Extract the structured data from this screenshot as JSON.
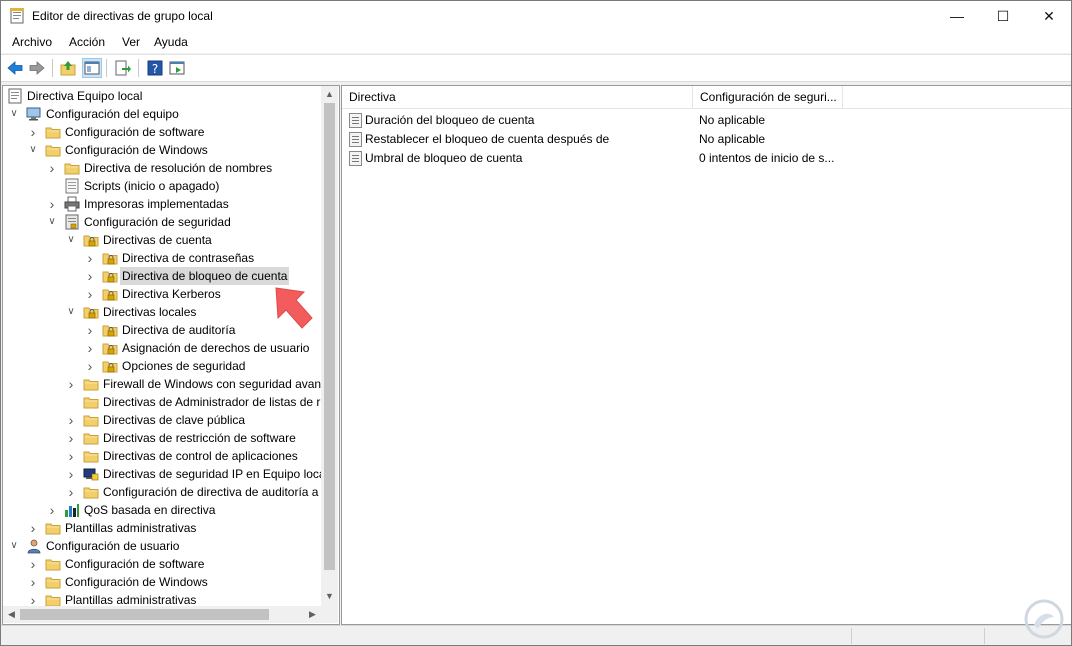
{
  "window": {
    "title": "Editor de directivas de grupo local"
  },
  "menu": [
    "Archivo",
    "Acción",
    "Ver",
    "Ayuda"
  ],
  "tree": [
    {
      "label": "Directiva Equipo local",
      "indent": 0,
      "expander": "",
      "icon": "policy-doc-icon"
    },
    {
      "label": "Configuración del equipo",
      "indent": 1,
      "expander": "open",
      "icon": "computer-icon"
    },
    {
      "label": "Configuración de software",
      "indent": 2,
      "expander": "closed",
      "icon": "folder-icon"
    },
    {
      "label": "Configuración de Windows",
      "indent": 2,
      "expander": "open",
      "icon": "folder-icon"
    },
    {
      "label": "Directiva de resolución de nombres",
      "indent": 3,
      "expander": "closed",
      "icon": "folder-icon"
    },
    {
      "label": "Scripts (inicio o apagado)",
      "indent": 3,
      "expander": "",
      "icon": "scripts-icon"
    },
    {
      "label": "Impresoras implementadas",
      "indent": 3,
      "expander": "closed",
      "icon": "printer-icon"
    },
    {
      "label": "Configuración de seguridad",
      "indent": 3,
      "expander": "open",
      "icon": "security-config-icon"
    },
    {
      "label": "Directivas de cuenta",
      "indent": 4,
      "expander": "open",
      "icon": "locked-folder-icon"
    },
    {
      "label": "Directiva de contraseñas",
      "indent": 5,
      "expander": "closed",
      "icon": "locked-folder-icon"
    },
    {
      "label": "Directiva de bloqueo de cuenta",
      "indent": 5,
      "expander": "closed",
      "icon": "locked-folder-icon",
      "selected": true
    },
    {
      "label": "Directiva Kerberos",
      "indent": 5,
      "expander": "closed",
      "icon": "locked-folder-icon"
    },
    {
      "label": "Directivas locales",
      "indent": 4,
      "expander": "open",
      "icon": "locked-folder-icon"
    },
    {
      "label": "Directiva de auditoría",
      "indent": 5,
      "expander": "closed",
      "icon": "locked-folder-icon"
    },
    {
      "label": "Asignación de derechos de usuario",
      "indent": 5,
      "expander": "closed",
      "icon": "locked-folder-icon"
    },
    {
      "label": "Opciones de seguridad",
      "indent": 5,
      "expander": "closed",
      "icon": "locked-folder-icon"
    },
    {
      "label": "Firewall de Windows con seguridad avanz",
      "indent": 4,
      "expander": "closed",
      "icon": "folder-icon"
    },
    {
      "label": "Directivas de Administrador de listas de r",
      "indent": 4,
      "expander": "",
      "icon": "folder-icon"
    },
    {
      "label": "Directivas de clave pública",
      "indent": 4,
      "expander": "closed",
      "icon": "folder-icon"
    },
    {
      "label": "Directivas de restricción de software",
      "indent": 4,
      "expander": "closed",
      "icon": "folder-icon"
    },
    {
      "label": "Directivas de control de aplicaciones",
      "indent": 4,
      "expander": "closed",
      "icon": "folder-icon"
    },
    {
      "label": "Directivas de seguridad IP en Equipo loca",
      "indent": 4,
      "expander": "closed",
      "icon": "ipsec-icon"
    },
    {
      "label": "Configuración de directiva de auditoría a",
      "indent": 4,
      "expander": "closed",
      "icon": "folder-icon"
    },
    {
      "label": "QoS basada en directiva",
      "indent": 3,
      "expander": "closed",
      "icon": "qos-chart-icon"
    },
    {
      "label": "Plantillas administrativas",
      "indent": 2,
      "expander": "closed",
      "icon": "folder-icon"
    },
    {
      "label": "Configuración de usuario",
      "indent": 1,
      "expander": "open",
      "icon": "user-icon"
    },
    {
      "label": "Configuración de software",
      "indent": 2,
      "expander": "closed",
      "icon": "folder-icon"
    },
    {
      "label": "Configuración de Windows",
      "indent": 2,
      "expander": "closed",
      "icon": "folder-icon"
    },
    {
      "label": "Plantillas administrativas",
      "indent": 2,
      "expander": "closed",
      "icon": "folder-icon"
    }
  ],
  "list": {
    "columns": [
      "Directiva",
      "Configuración de seguri..."
    ],
    "rows": [
      {
        "name": "Duración del bloqueo de cuenta",
        "value": "No aplicable"
      },
      {
        "name": "Restablecer el bloqueo de cuenta después de",
        "value": "No aplicable"
      },
      {
        "name": "Umbral de bloqueo de cuenta",
        "value": "0 intentos de inicio de s..."
      }
    ]
  },
  "icons": {
    "toolbar": [
      "back-arrow-icon",
      "forward-arrow-icon",
      "up-folder-icon",
      "show-hide-tree-icon",
      "export-list-icon",
      "help-icon",
      "properties-view-icon"
    ]
  },
  "colors": {
    "accent_arrow": "#f25c5c",
    "selection": "#d9d9d9",
    "folder": "#f2cf6b"
  }
}
